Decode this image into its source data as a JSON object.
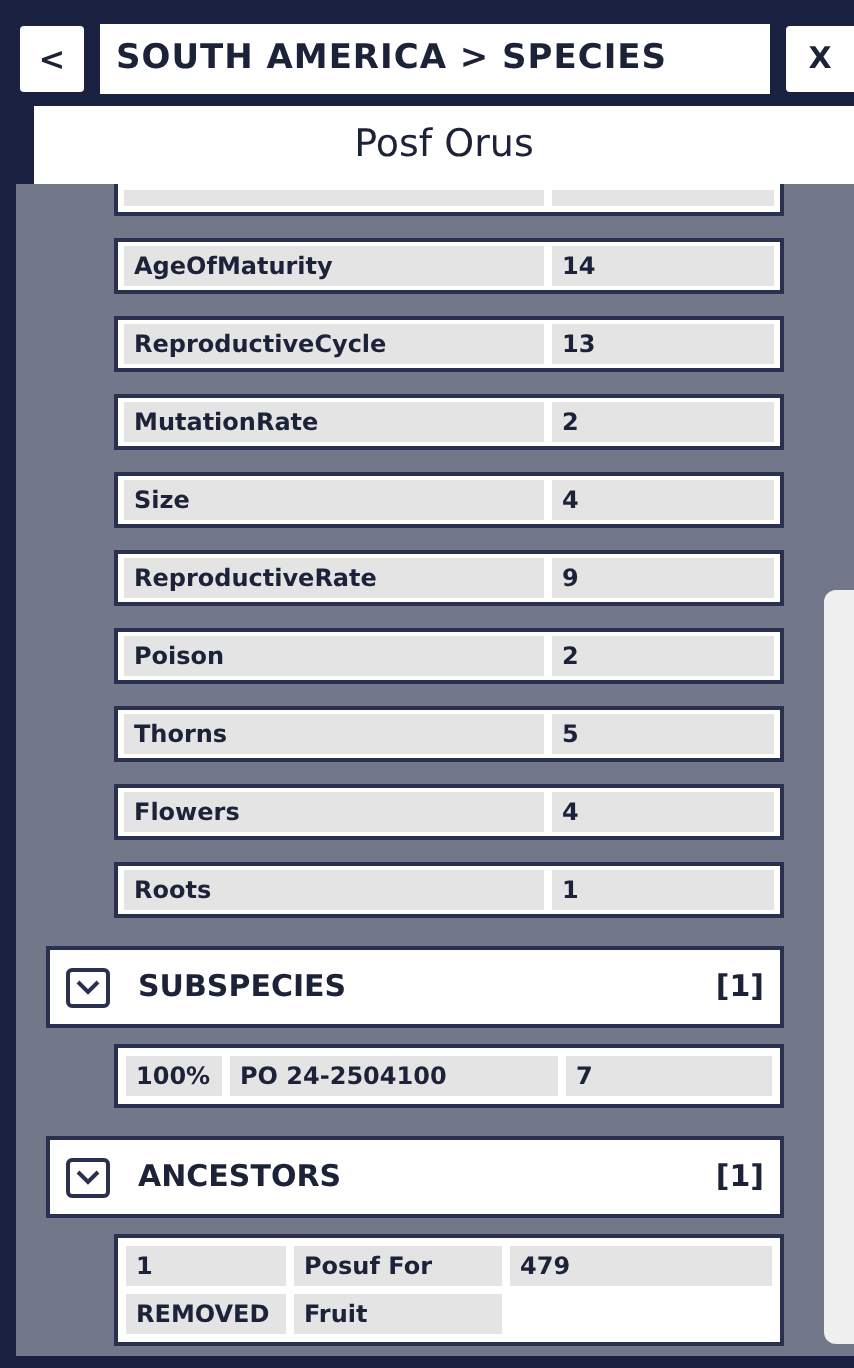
{
  "header": {
    "back": "<",
    "title": "SOUTH AMERICA > SPECIES",
    "close": "X"
  },
  "species_name": "Posf Orus",
  "traits": [
    {
      "label": "AgeOfMaturity",
      "value": "14"
    },
    {
      "label": "ReproductiveCycle",
      "value": "13"
    },
    {
      "label": "MutationRate",
      "value": "2"
    },
    {
      "label": "Size",
      "value": "4"
    },
    {
      "label": "ReproductiveRate",
      "value": "9"
    },
    {
      "label": "Poison",
      "value": "2"
    },
    {
      "label": "Thorns",
      "value": "5"
    },
    {
      "label": "Flowers",
      "value": "4"
    },
    {
      "label": "Roots",
      "value": "1"
    }
  ],
  "sections": [
    {
      "title": "SUBSPECIES",
      "count": "[1]",
      "expanded": true,
      "rows": [
        [
          "100%",
          "PO 24-2504100",
          "7"
        ]
      ]
    },
    {
      "title": "ANCESTORS",
      "count": "[1]",
      "expanded": true,
      "rows": [
        [
          "1",
          "Posuf For",
          "479"
        ],
        [
          "REMOVED",
          "Fruit"
        ]
      ]
    }
  ]
}
